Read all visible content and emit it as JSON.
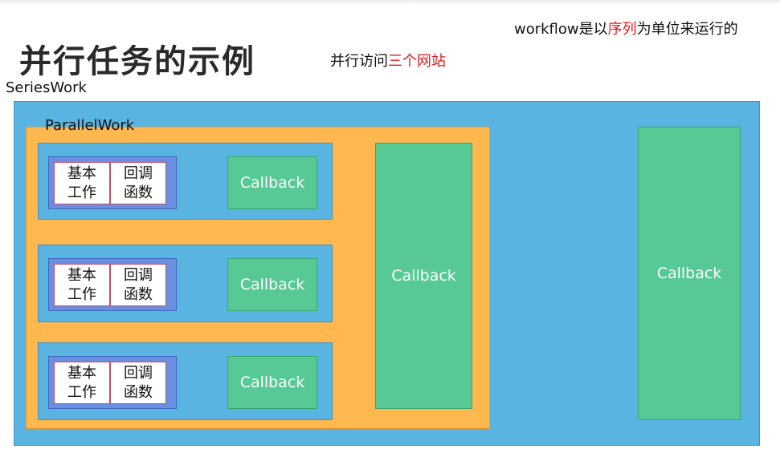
{
  "header": {
    "title": "并行任务的示例",
    "subtitle_prefix": "并行访问",
    "subtitle_highlight": "三个网站",
    "note_prefix": "workflow是以",
    "note_highlight": "序列",
    "note_suffix": "为单位来运行的"
  },
  "diagram": {
    "series_label": "SeriesWork",
    "parallel_label": "ParallelWork",
    "rows": [
      {
        "basic": "基本\n工作",
        "callback_func": "回调\n函数",
        "callback": "Callback"
      },
      {
        "basic": "基本\n工作",
        "callback_func": "回调\n函数",
        "callback": "Callback"
      },
      {
        "basic": "基本\n工作",
        "callback_func": "回调\n函数",
        "callback": "Callback"
      }
    ],
    "parallel_callback": "Callback",
    "series_callback": "Callback"
  },
  "colors": {
    "series_bg": "#5ab4e2",
    "parallel_bg": "#ffb74f",
    "work_bg": "#6a8fe0",
    "callback_bg": "#56c994",
    "highlight_text": "#e31a1a"
  }
}
